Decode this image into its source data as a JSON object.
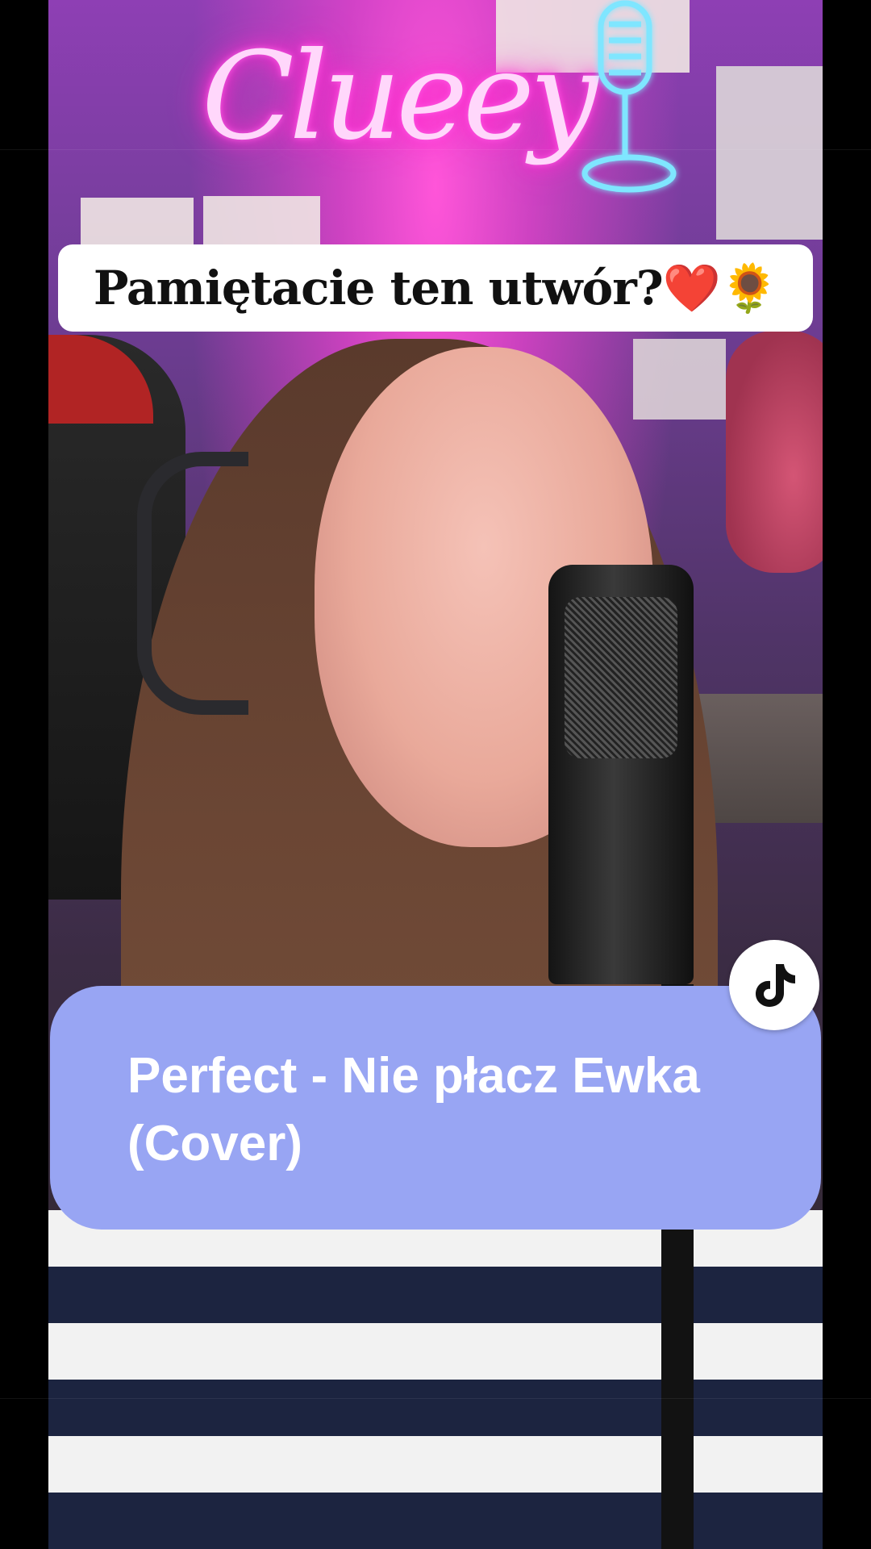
{
  "caption": {
    "text": "Pamiętacie ten utwór?❤️🌻"
  },
  "neon_sign": {
    "text": "Clueey"
  },
  "song_card": {
    "title": "Perfect - Nie płacz Ewka (Cover)"
  },
  "icons": {
    "tiktok": "tiktok-logo-icon",
    "neon_mic": "microphone-icon"
  },
  "colors": {
    "song_card_bg": "#98a5f3",
    "caption_bg": "#ffffff",
    "neon_pink": "#ff2fd0",
    "neon_blue": "#2fd0ff"
  }
}
